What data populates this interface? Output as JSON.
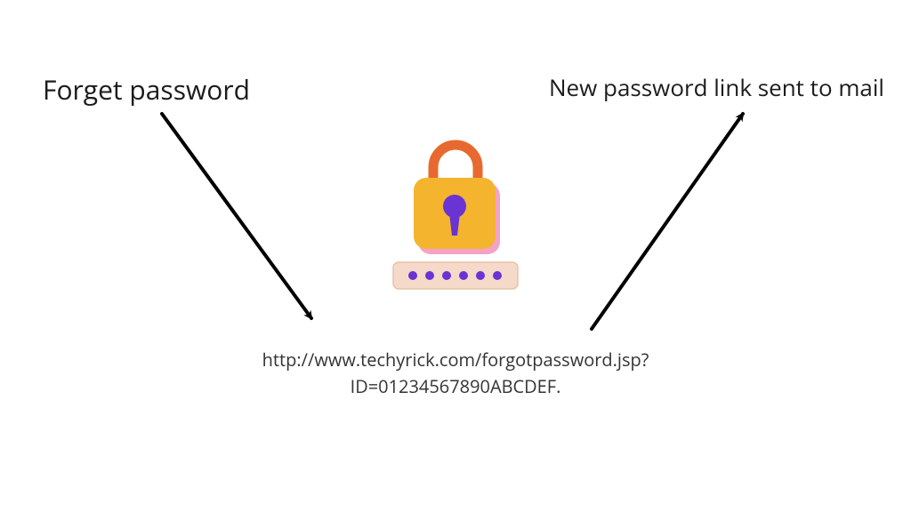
{
  "labels": {
    "left": "Forget password",
    "right": "New password link sent to mail",
    "url_line1": "http://www.techyrick.com/forgotpassword.jsp?",
    "url_line2": "ID=01234567890ABCDEF."
  },
  "icon": {
    "name": "lock-password-icon"
  },
  "colors": {
    "text": "#1c1c1c",
    "arrow": "#000000",
    "lock_body": "#f4b42e",
    "lock_shackle": "#e8692f",
    "lock_accent_pink": "#f4a3c6",
    "lock_keyhole": "#6a33d4",
    "dots": "#6a33d4",
    "dots_bg": "#f5d9c9",
    "dots_bg_border": "#e7c3aa"
  }
}
